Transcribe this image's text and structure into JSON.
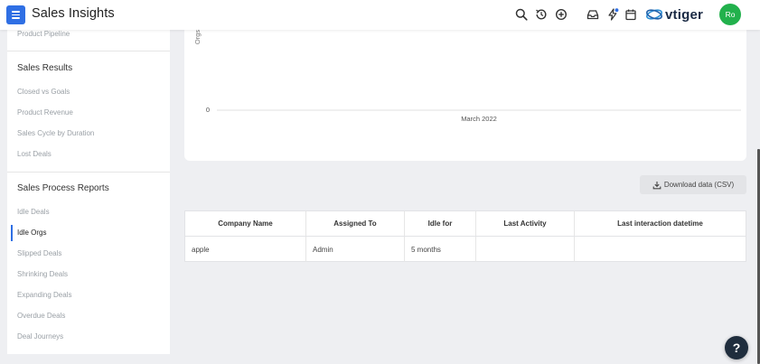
{
  "header": {
    "title": "Sales Insights",
    "avatar_initials": "Ro",
    "logo_text": "vtiger",
    "icons": [
      "menu-icon",
      "search-icon",
      "history-icon",
      "plus-circle-icon",
      "inbox-icon",
      "lightning-icon",
      "calendar-icon"
    ]
  },
  "sidebar": {
    "top_item": "Product Pipeline",
    "sections": [
      {
        "title": "Sales Results",
        "items": [
          "Closed vs Goals",
          "Product Revenue",
          "Sales Cycle by Duration",
          "Lost Deals"
        ]
      },
      {
        "title": "Sales Process Reports",
        "items": [
          "Idle Deals",
          "Idle Orgs",
          "Slipped Deals",
          "Shrinking Deals",
          "Expanding Deals",
          "Overdue Deals",
          "Deal Journeys"
        ]
      }
    ],
    "active_item": "Idle Orgs"
  },
  "chart_data": {
    "type": "bar",
    "ylabel": "Orgs",
    "y_ticks": [
      "0"
    ],
    "categories": [
      "March 2022"
    ],
    "values": [],
    "grid": false
  },
  "download": {
    "label": "Download data (CSV)"
  },
  "table": {
    "columns": [
      "Company Name",
      "Assigned To",
      "Idle for",
      "Last Activity",
      "Last interaction datetime"
    ],
    "rows": [
      [
        "apple",
        "Admin",
        "5 months",
        "",
        ""
      ]
    ]
  },
  "colors": {
    "accent": "#2f6fe4",
    "avatar": "#22b14c",
    "help": "#1f2d3d"
  }
}
